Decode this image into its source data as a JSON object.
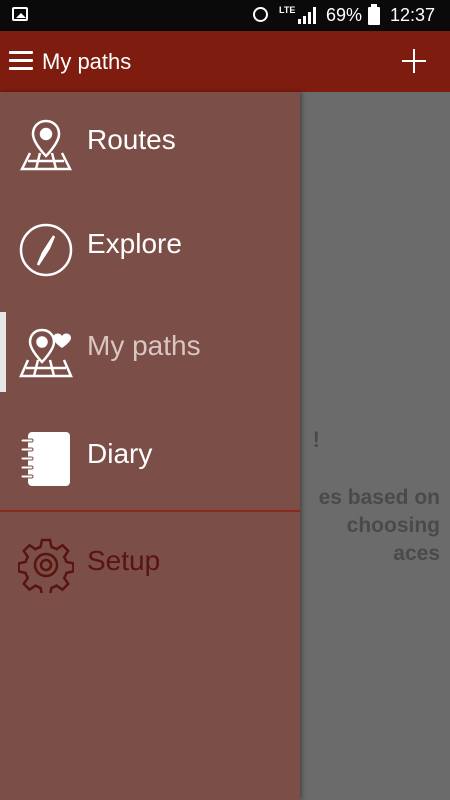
{
  "status_bar": {
    "lte": "LTE",
    "battery": "69%",
    "time": "12:37"
  },
  "toolbar": {
    "title": "My paths"
  },
  "content": {
    "title_fragment": "!",
    "body_line1": "es based on",
    "body_line2": "choosing",
    "body_line3": "aces"
  },
  "drawer": {
    "items": [
      {
        "label": "Routes",
        "icon": "map-pin-icon"
      },
      {
        "label": "Explore",
        "icon": "compass-icon"
      },
      {
        "label": "My paths",
        "icon": "map-heart-icon",
        "active": true
      },
      {
        "label": "Diary",
        "icon": "notebook-icon"
      },
      {
        "label": "Setup",
        "icon": "gear-icon"
      }
    ]
  },
  "colors": {
    "toolbar": "#7e1c10",
    "drawer": "#7b4e47",
    "overlay": "#6b6b6b",
    "setup_text": "#5a1410"
  }
}
